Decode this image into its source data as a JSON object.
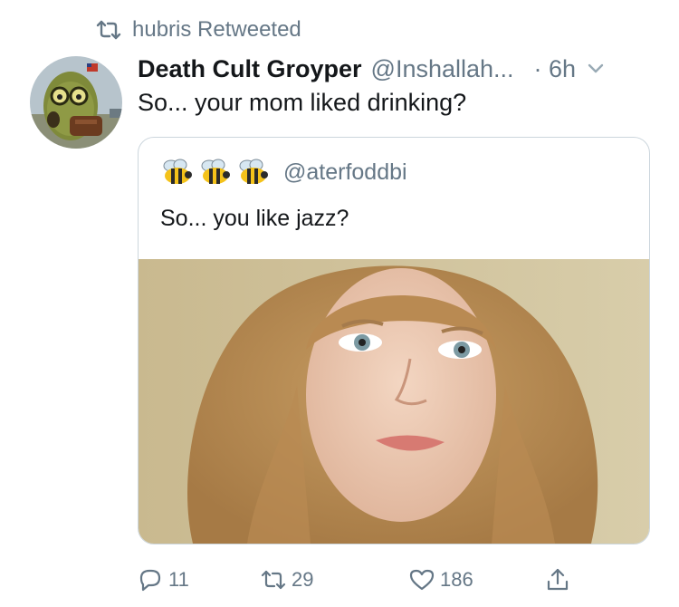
{
  "retweet": {
    "icon": "retweet-icon",
    "text": "hubris Retweeted"
  },
  "tweet": {
    "display_name": "Death Cult Groyper",
    "handle": "@Inshallah...",
    "time": "· 6h",
    "text": "So... your mom liked drinking?"
  },
  "quote": {
    "emoji_icon": "bee-icon",
    "handle": "@aterfoddbi",
    "text": "So... you like jazz?"
  },
  "actions": {
    "reply_count": "11",
    "retweet_count": "29",
    "like_count": "186"
  },
  "colors": {
    "secondary": "#657786",
    "border": "#ccd6dd",
    "text": "#14171a"
  }
}
